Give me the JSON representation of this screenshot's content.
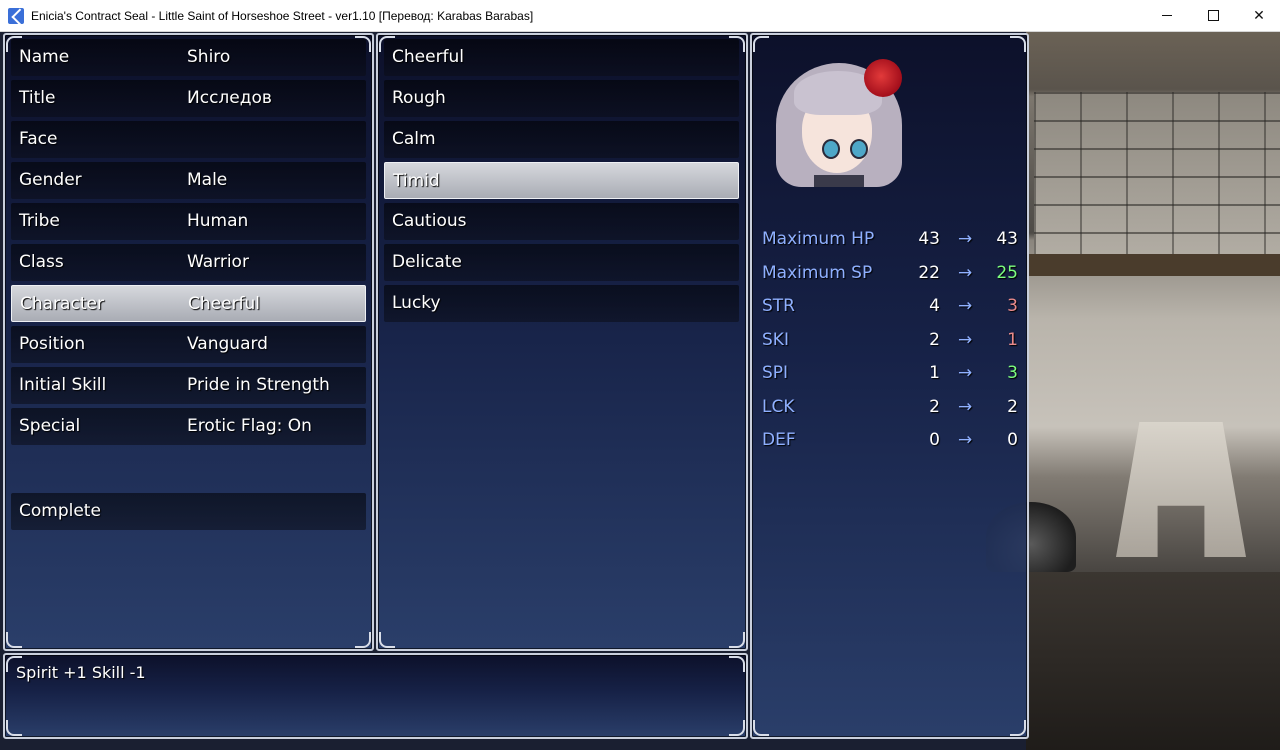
{
  "window": {
    "title": "Enicia's Contract Seal - Little Saint of Horseshoe Street - ver1.10 [Перевод: Karabas Barabas]",
    "controls": [
      "minimize",
      "maximize",
      "close"
    ]
  },
  "attributes": [
    {
      "key": "Name",
      "value": "Shiro"
    },
    {
      "key": "Title",
      "value": "Исследов"
    },
    {
      "key": "Face",
      "value": ""
    },
    {
      "key": "Gender",
      "value": "Male"
    },
    {
      "key": "Tribe",
      "value": "Human"
    },
    {
      "key": "Class",
      "value": "Warrior"
    },
    {
      "key": "Character",
      "value": "Cheerful",
      "selected": true
    },
    {
      "key": "Position",
      "value": "Vanguard"
    },
    {
      "key": "Initial Skill",
      "value": "Pride in Strength"
    },
    {
      "key": "Special",
      "value": "Erotic Flag: On"
    }
  ],
  "complete_label": "Complete",
  "character_options": [
    {
      "label": "Cheerful"
    },
    {
      "label": "Rough"
    },
    {
      "label": "Calm"
    },
    {
      "label": "Timid",
      "selected": true
    },
    {
      "label": "Cautious"
    },
    {
      "label": "Delicate"
    },
    {
      "label": "Lucky"
    }
  ],
  "help_text": "Spirit +1 Skill -1",
  "arrow_glyph": "→",
  "stats": [
    {
      "label": "Maximum HP",
      "current": "43",
      "next": "43",
      "next_color": "#ffffff"
    },
    {
      "label": "Maximum SP",
      "current": "22",
      "next": "25",
      "next_color": "#7dff7d"
    },
    {
      "label": "STR",
      "current": "4",
      "next": "3",
      "next_color": "#e98a8a"
    },
    {
      "label": "SKI",
      "current": "2",
      "next": "1",
      "next_color": "#e98a8a"
    },
    {
      "label": "SPI",
      "current": "1",
      "next": "3",
      "next_color": "#7dff7d"
    },
    {
      "label": "LCK",
      "current": "2",
      "next": "2",
      "next_color": "#ffffff"
    },
    {
      "label": "DEF",
      "current": "0",
      "next": "0",
      "next_color": "#ffffff"
    }
  ],
  "colors": {
    "stat_label": "#8fb0ff",
    "increase": "#7dff7d",
    "decrease": "#e98a8a",
    "panel_border": "#c9cfdc"
  }
}
